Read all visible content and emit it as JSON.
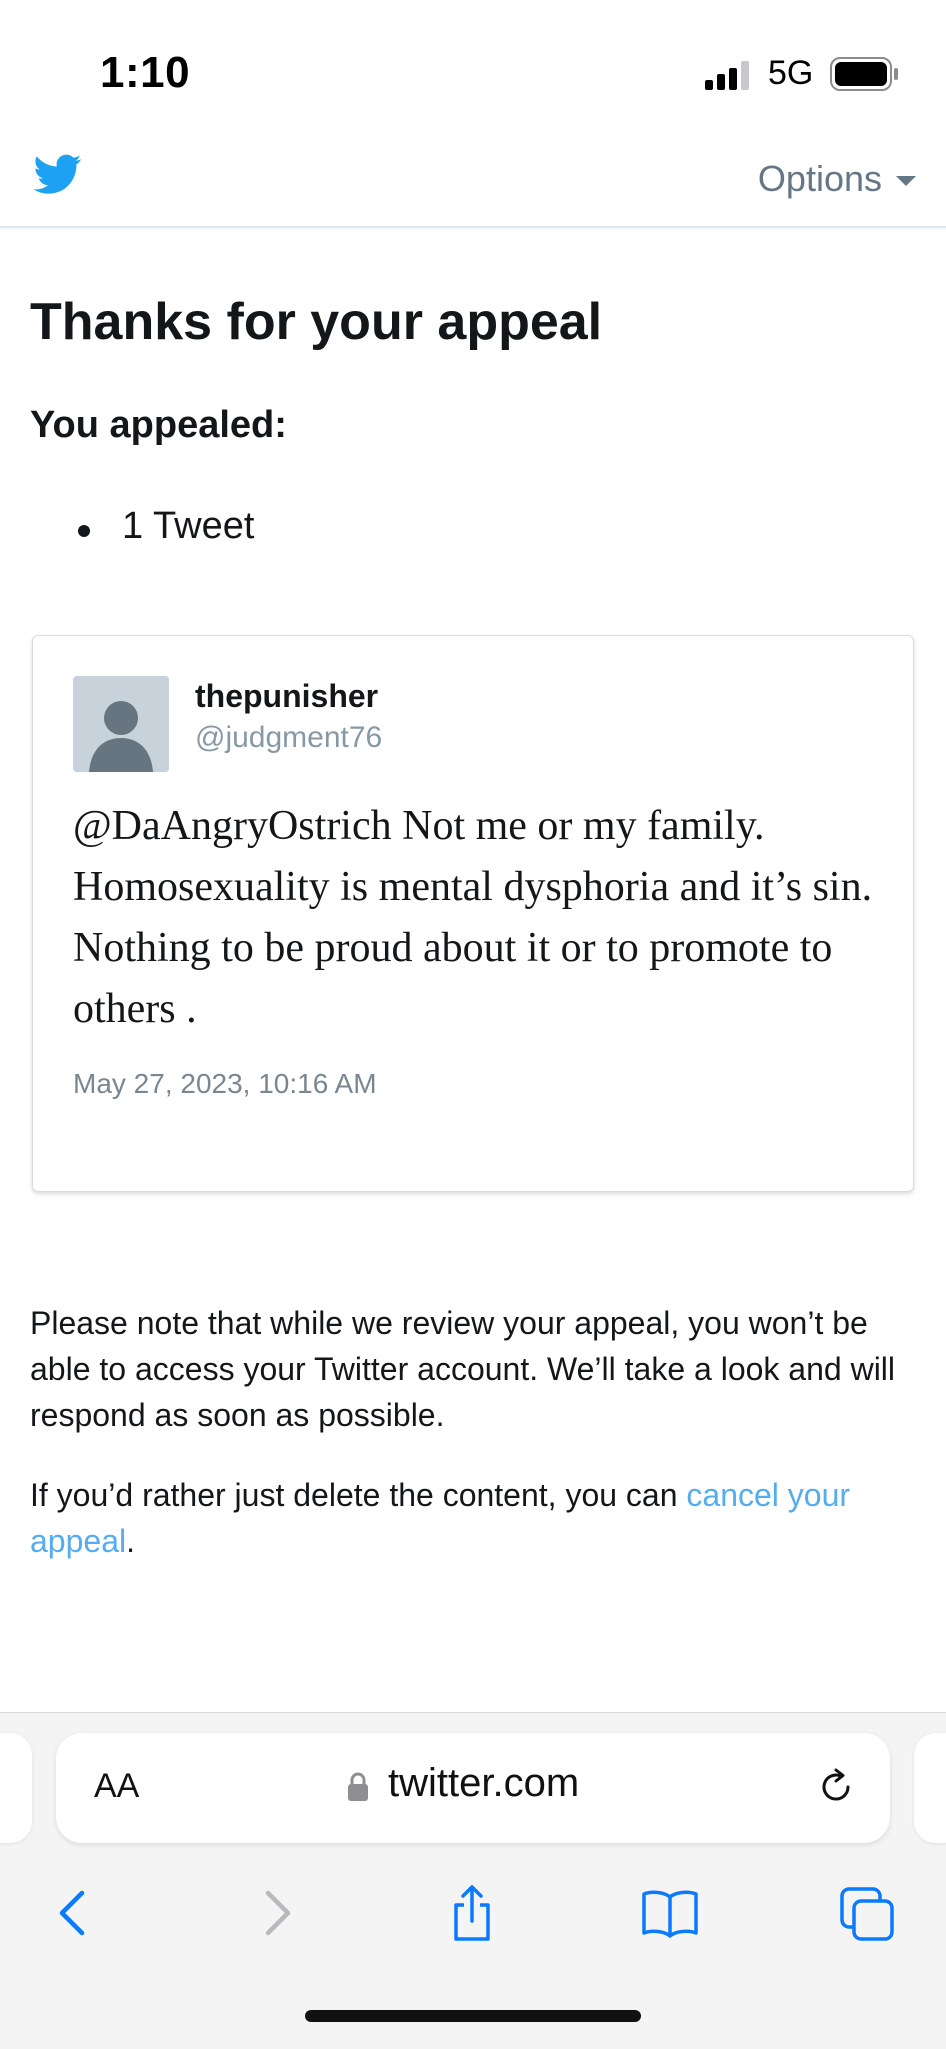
{
  "status_bar": {
    "time": "1:10",
    "network": "5G"
  },
  "header": {
    "options_label": "Options"
  },
  "page": {
    "title": "Thanks for your appeal",
    "subhead": "You appealed:",
    "items": [
      "1 Tweet"
    ]
  },
  "tweet": {
    "display_name": "thepunisher",
    "handle": "@judgment76",
    "text": "@DaAngryOstrich Not me or my family. Homosexuality is mental dysphoria and it’s sin. Nothing to be proud about it or to promote to others .",
    "date": "May 27, 2023, 10:16 AM"
  },
  "notes": {
    "review_notice": "Please note that while we review your appeal, you won’t be able to access your Twitter account. We’ll take a look and will respond as soon as possible.",
    "delete_prefix": "If you’d rather just delete the content, you can ",
    "cancel_link": "cancel your appeal",
    "delete_suffix": "."
  },
  "browser": {
    "text_size_label": "AA",
    "url": "twitter.com"
  },
  "colors": {
    "twitter_blue": "#1da1f2",
    "link_blue": "#55acee",
    "safari_blue": "#0a7aff"
  },
  "icons": [
    "signal-icon",
    "battery-icon",
    "twitter-bird-icon",
    "chevron-down-icon",
    "lock-icon",
    "reload-icon",
    "back-icon",
    "forward-icon",
    "share-icon",
    "bookmarks-icon",
    "tabs-icon"
  ]
}
